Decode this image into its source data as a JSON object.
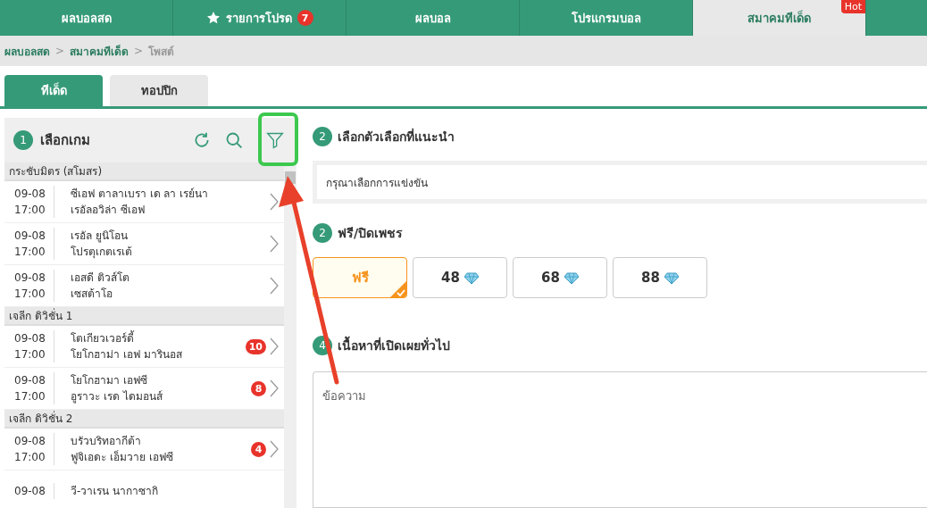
{
  "nav": [
    {
      "label": "ผลบอลสด",
      "selected": false,
      "kind": "plain"
    },
    {
      "label": "รายการโปรด",
      "selected": false,
      "kind": "star",
      "badge": "7"
    },
    {
      "label": "ผลบอล",
      "selected": false,
      "kind": "plain"
    },
    {
      "label": "โปรแกรมบอล",
      "selected": false,
      "kind": "plain"
    },
    {
      "label": "สมาคมทีเด็ด",
      "selected": true,
      "kind": "hot",
      "tag": "Hot"
    }
  ],
  "breadcrumb": [
    {
      "label": "ผลบอลสด",
      "kind": "link"
    },
    {
      "label": ">",
      "kind": "sep"
    },
    {
      "label": "สมาคมทีเด็ด",
      "kind": "link"
    },
    {
      "label": ">",
      "kind": "sep"
    },
    {
      "label": "โพสต์",
      "kind": "current"
    }
  ],
  "tabs": [
    {
      "label": "ทีเด็ด",
      "selected": true
    },
    {
      "label": "ทอปปิก",
      "selected": false
    }
  ],
  "game_panel": {
    "step": "1",
    "title": "เลือกเกม",
    "groups": [
      {
        "name": "กระชับมิตร (สโมสร)",
        "matches": [
          {
            "date": "09-08",
            "time": "17:00",
            "home": "ซีเอฟ ตาลาเบรา เด ลา เรย์นา",
            "away": "เรอัลอวิล่า ซีเอฟ"
          },
          {
            "date": "09-08",
            "time": "17:00",
            "home": "เรอัล ยูนิโอน",
            "away": "โปรตุเกตเรเต้"
          },
          {
            "date": "09-08",
            "time": "17:00",
            "home": "เอสดี ติวส์โต",
            "away": "เซสต้าโอ"
          }
        ]
      },
      {
        "name": "เจลีก ดิวิชั่น 1",
        "matches": [
          {
            "date": "09-08",
            "time": "17:00",
            "home": "โตเกียวเวอร์ดี้",
            "away": "โยโกฮาม่า เอฟ มารินอส",
            "badge": "10"
          },
          {
            "date": "09-08",
            "time": "17:00",
            "home": "โยโกฮามา เอฟซี",
            "away": "อูราวะ เรด ไดมอนส์",
            "badge": "8"
          }
        ]
      },
      {
        "name": "เจลีก ดิวิชั่น 2",
        "matches": [
          {
            "date": "09-08",
            "time": "17:00",
            "home": "บรัวบริทอากีต้า",
            "away": "ฟูจิเอดะ เอ็มวาย เอฟซี",
            "badge": "4"
          },
          {
            "date": "09-08",
            "home": "วี-วาเรน นากาซากิ"
          }
        ]
      }
    ]
  },
  "options": {
    "step": "2",
    "title": "เลือกตัวเลือกที่แนะนำ",
    "placeholder": "กรุณาเลือกการแข่งขัน"
  },
  "price": {
    "step": "2",
    "title": "ฟรี/ปิดเพชร",
    "choices": [
      {
        "label": "ฟรี",
        "kind": "free",
        "selected": true
      },
      {
        "label": "48",
        "kind": "diamond",
        "selected": false
      },
      {
        "label": "68",
        "kind": "diamond",
        "selected": false
      },
      {
        "label": "88",
        "kind": "diamond",
        "selected": false
      }
    ]
  },
  "content": {
    "step": "4",
    "title": "เนื้อหาที่เปิดเผยทั่วไป",
    "placeholder": "ข้อความ"
  }
}
